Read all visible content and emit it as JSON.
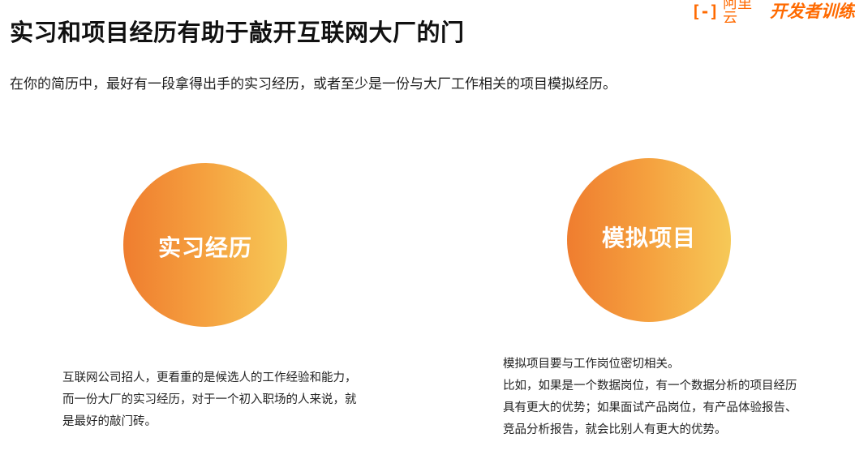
{
  "logo": {
    "mark": "[-]",
    "name": "阿里云",
    "sub": "开发者训练"
  },
  "title": "实习和项目经历有助于敲开互联网大厂的门",
  "subtitle": "在你的简历中，最好有一段拿得出手的实习经历，或者至少是一份与大厂工作相关的项目模拟经历。",
  "cards": [
    {
      "label": "实习经历",
      "lines": [
        "互联网公司招人，更看重的是候选人的工作经验和能力，",
        "而一份大厂的实习经历，对于一个初入职场的人来说，就",
        "是最好的敲门砖。"
      ]
    },
    {
      "label": "模拟项目",
      "lines": [
        "模拟项目要与工作岗位密切相关。",
        "比如，如果是一个数据岗位，有一个数据分析的项目经历",
        "具有更大的优势；如果面试产品岗位，有产品体验报告、",
        "竞品分析报告，就会比别人有更大的优势。"
      ]
    }
  ],
  "colors": {
    "accent": "#ff6a00",
    "gradient_start": "#ef7d2f",
    "gradient_mid": "#f5a13f",
    "gradient_end": "#f6c957"
  }
}
